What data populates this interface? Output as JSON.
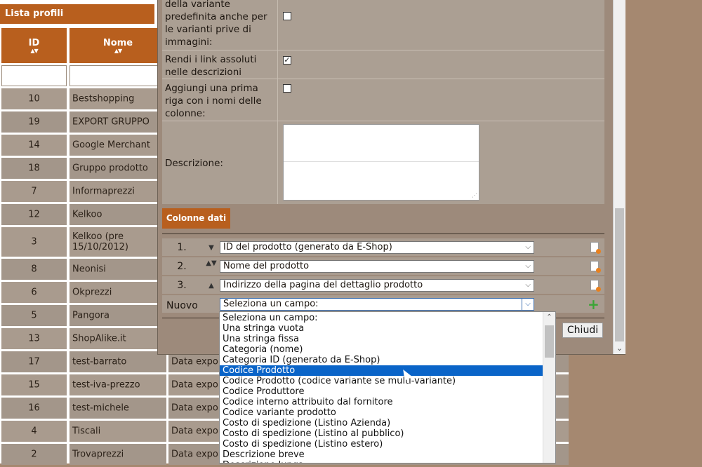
{
  "list": {
    "title": "Lista profili",
    "headers": {
      "id": "ID",
      "name": "Nome",
      "sort_glyph": "▲▼"
    },
    "rows": [
      {
        "id": "10",
        "name": "Bestshopping",
        "desc": ""
      },
      {
        "id": "19",
        "name": "EXPORT GRUPPO",
        "desc": ""
      },
      {
        "id": "14",
        "name": "Google Merchant",
        "desc": ""
      },
      {
        "id": "18",
        "name": "Gruppo prodotto",
        "desc": ""
      },
      {
        "id": "7",
        "name": "Informaprezzi",
        "desc": ""
      },
      {
        "id": "12",
        "name": "Kelkoo",
        "desc": ""
      },
      {
        "id": "3",
        "name": "Kelkoo (pre 15/10/2012)",
        "desc": ""
      },
      {
        "id": "8",
        "name": "Neonisi",
        "desc": ""
      },
      {
        "id": "6",
        "name": "Okprezzi",
        "desc": ""
      },
      {
        "id": "5",
        "name": "Pangora",
        "desc": ""
      },
      {
        "id": "13",
        "name": "ShopAlike.it",
        "desc": ""
      },
      {
        "id": "17",
        "name": "test-barrato",
        "desc": "Data expo"
      },
      {
        "id": "15",
        "name": "test-iva-prezzo",
        "desc": "Data expo"
      },
      {
        "id": "16",
        "name": "test-michele",
        "desc": "Data expo"
      },
      {
        "id": "4",
        "name": "Tiscali",
        "desc": "Data expo"
      },
      {
        "id": "2",
        "name": "Trovaprezzi",
        "desc": "Data expo"
      }
    ]
  },
  "dialog": {
    "fields": [
      {
        "label": "della variante predefinita anche per le varianti prive di immagini:",
        "checked": false
      },
      {
        "label": "Rendi i link assoluti nelle descrizioni",
        "checked": true
      },
      {
        "label": "Aggiungi una prima riga con i nomi delle colonne:",
        "checked": false
      }
    ],
    "description_label": "Descrizione:",
    "columns_tab": "Colonne dati",
    "columns": [
      {
        "num": "1.",
        "arrow": "▼",
        "value": "ID del prodotto (generato da E-Shop)"
      },
      {
        "num": "2.",
        "arrow": "▲▼",
        "value": "Nome del prodotto"
      },
      {
        "num": "3.",
        "arrow": "▲",
        "value": "Indirizzo della pagina del dettaglio prodotto"
      }
    ],
    "new_label": "Nuovo",
    "new_select_value": "Seleziona un campo:",
    "add_glyph": "+",
    "close_label": "Chiudi",
    "dropdown_options": [
      "Seleziona un campo:",
      "Una stringa vuota",
      "Una stringa fissa",
      "Categoria (nome)",
      "Categoria ID (generato da E-Shop)",
      "Codice Prodotto",
      "Codice Prodotto (codice variante se multi-variante)",
      "Codice Produttore",
      "Codice interno attribuito dal fornitore",
      "Codice variante prodotto",
      "Costo di spedizione (Listino Azienda)",
      "Costo di spedizione (Listino al pubblico)",
      "Costo di spedizione (Listino estero)",
      "Descrizione breve",
      "Descrizione lunga"
    ],
    "dropdown_selected_index": 5
  },
  "colors": {
    "accent": "#b85f1e",
    "selection": "#0a64c8",
    "add": "#3aa536"
  }
}
